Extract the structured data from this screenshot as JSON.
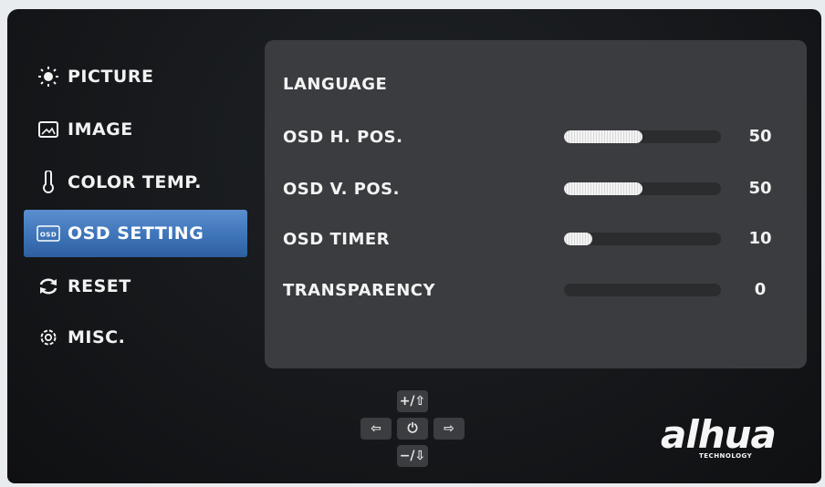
{
  "sidebar": {
    "items": [
      {
        "label": "PICTURE",
        "icon": "sun-icon",
        "active": false
      },
      {
        "label": "IMAGE",
        "icon": "image-icon",
        "active": false
      },
      {
        "label": "COLOR TEMP.",
        "icon": "thermometer-icon",
        "active": false
      },
      {
        "label": "OSD SETTING",
        "icon": "osd-icon",
        "active": true
      },
      {
        "label": "RESET",
        "icon": "reset-icon",
        "active": false
      },
      {
        "label": "MISC.",
        "icon": "gear-icon",
        "active": false
      }
    ]
  },
  "panel": {
    "rows": [
      {
        "label": "LANGUAGE"
      },
      {
        "label": "OSD H. POS.",
        "value": "50",
        "fraction": 0.5
      },
      {
        "label": "OSD V. POS.",
        "value": "50",
        "fraction": 0.5
      },
      {
        "label": "OSD TIMER",
        "value": "10",
        "fraction": 0.18
      },
      {
        "label": "TRANSPARENCY",
        "value": "0",
        "fraction": 0.0
      }
    ]
  },
  "keys": {
    "up": "+/⇧",
    "left": "⇦",
    "power": "⏻",
    "right": "⇨",
    "down": "−/⇩"
  },
  "brand": {
    "name": "alhua",
    "tagline": "TECHNOLOGY"
  },
  "colors": {
    "active_tab": "#3e74b8",
    "panel_bg": "#3a3c3f",
    "screen_bg": "#16181b"
  }
}
